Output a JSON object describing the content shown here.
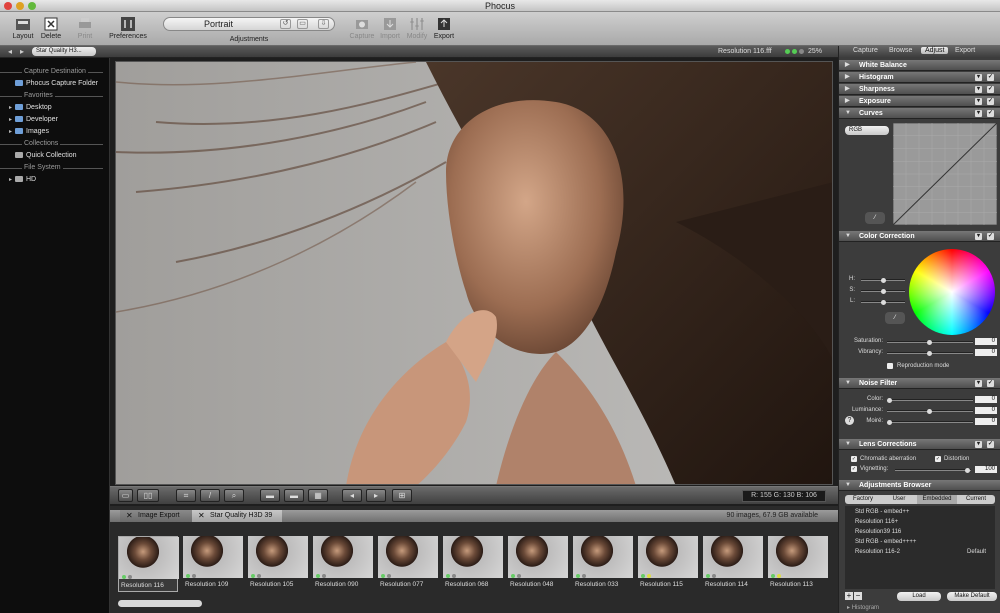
{
  "app": {
    "title": "Phocus"
  },
  "toolbar": {
    "layout": "Layout",
    "delete": "Delete",
    "print": "Print",
    "preferences": "Preferences",
    "preset": "Portrait",
    "adjustments": "Adjustments",
    "capture": "Capture",
    "import": "Import",
    "modify": "Modify",
    "export": "Export"
  },
  "subbar": {
    "collection": "Star Quality H3...",
    "resolution": "Resolution 116.fff",
    "zoom": "25%"
  },
  "sidebar": {
    "capture_header": "Capture Destination",
    "capture_item": "Phocus Capture Folder",
    "favorites_header": "Favorites",
    "favorites": [
      "Desktop",
      "Developer",
      "Images"
    ],
    "collections_header": "Collections",
    "collections_item": "Quick Collection",
    "fs_header": "File System",
    "fs_item": "HD"
  },
  "readout": {
    "text": "R: 155   G: 130   B: 106"
  },
  "filmstrip": {
    "tabs": [
      "Image Export",
      "Star Quality H3D 39"
    ],
    "status": "90 images, 67.9 GB available",
    "thumbs": [
      "Resolution 116",
      "Resolution 109",
      "Resolution 105",
      "Resolution 090",
      "Resolution 077",
      "Resolution 068",
      "Resolution 048",
      "Resolution 033",
      "Resolution 115",
      "Resolution 114",
      "Resolution 113"
    ]
  },
  "panel": {
    "tabs": [
      "Capture",
      "Browse",
      "Adjust",
      "Export"
    ],
    "sections": {
      "white_balance": "White Balance",
      "histogram": "Histogram",
      "sharpness": "Sharpness",
      "exposure": "Exposure",
      "curves": "Curves",
      "color_correction": "Color Correction",
      "noise_filter": "Noise Filter",
      "lens_corrections": "Lens Corrections",
      "adjustments_browser": "Adjustments Browser"
    },
    "curves_channel": "RGB",
    "cc": {
      "h": "H:",
      "s": "S:",
      "l": "L:",
      "saturation": "Saturation:",
      "vibrancy": "Vibrancy:",
      "saturation_val": "0",
      "vibrancy_val": "0",
      "reproduction": "Reproduction mode"
    },
    "noise": {
      "color": "Color:",
      "luminance": "Luminance:",
      "moire": "Moiré:",
      "vals": [
        "0",
        "0",
        "0"
      ]
    },
    "lens": {
      "ca": "Chromatic aberration",
      "distortion": "Distortion",
      "vignetting": "Vignetting:",
      "vignetting_val": "100"
    },
    "browser": {
      "tabs": [
        "Factory",
        "User",
        "Embedded",
        "Current"
      ],
      "items": [
        "Std RGB - embed++",
        "Resolution 116+",
        "Resolution39 116",
        "Std RGB - embed++++",
        "Resolution 116-2"
      ],
      "default_tag": "Default",
      "load": "Load",
      "make_default": "Make Default"
    },
    "histogram_footer": "Histogram"
  }
}
